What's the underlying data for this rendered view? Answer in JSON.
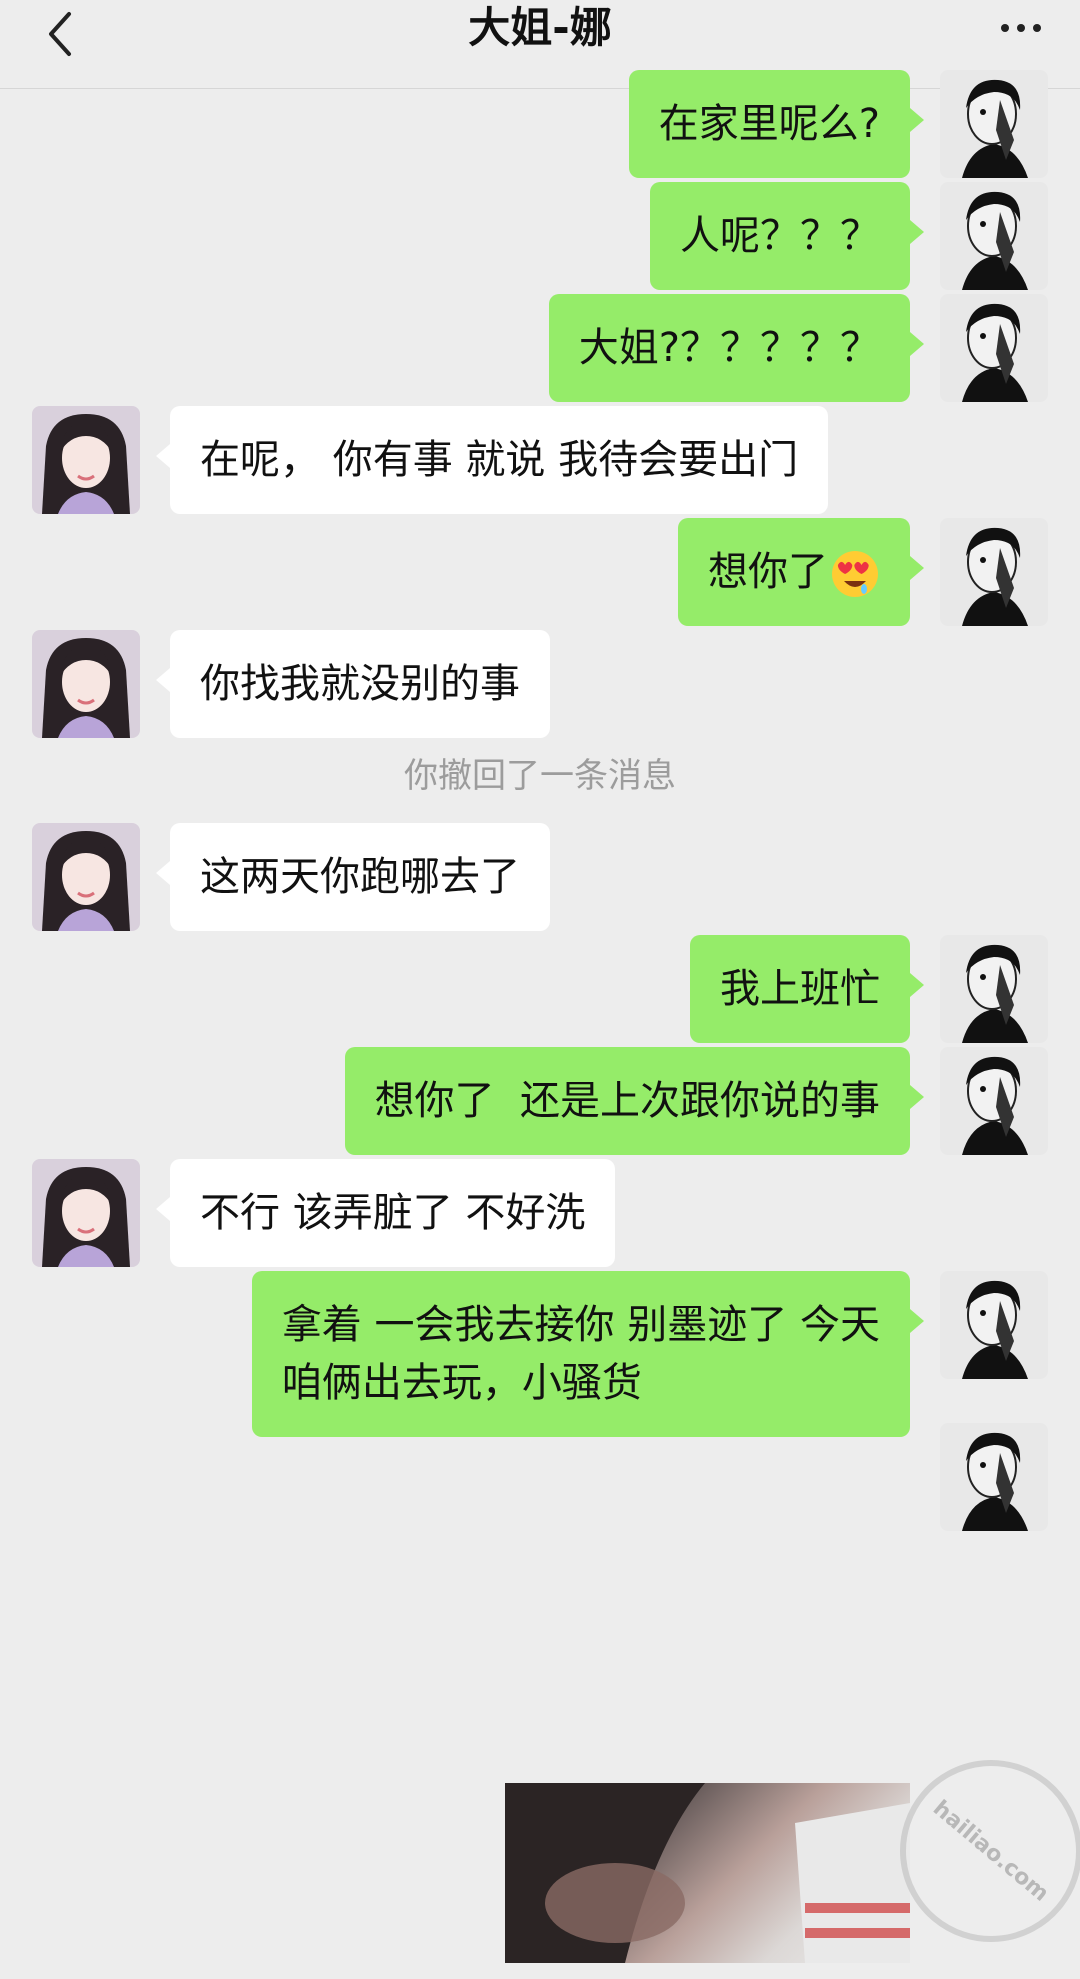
{
  "header": {
    "title": "大姐-娜"
  },
  "messages": [
    {
      "side": "right",
      "text": "在家里呢么?"
    },
    {
      "side": "right",
      "text": "人呢？？？"
    },
    {
      "side": "right",
      "text": "大姐?？？？？？"
    },
    {
      "side": "left",
      "text": "在呢， 你有事 就说 我待会要出门"
    },
    {
      "side": "right",
      "text": "想你了",
      "emoji": "heart-eyes-emoji"
    },
    {
      "side": "left",
      "text": "你找我就没别的事"
    },
    {
      "side": "left",
      "text": "这两天你跑哪去了"
    },
    {
      "side": "right",
      "text": "我上班忙"
    },
    {
      "side": "right",
      "text": "想你了  还是上次跟你说的事"
    },
    {
      "side": "left",
      "text": "不行 该弄脏了 不好洗"
    },
    {
      "side": "right",
      "text": "拿着 一会我去接你 别墨迹了 今天\n咱俩出去玩，小骚货"
    }
  ],
  "system_notice": "你撤回了一条消息",
  "watermark": "hailiao.com",
  "colors": {
    "sent_bubble": "#95ec69",
    "received_bubble": "#ffffff",
    "background": "#ededed"
  }
}
